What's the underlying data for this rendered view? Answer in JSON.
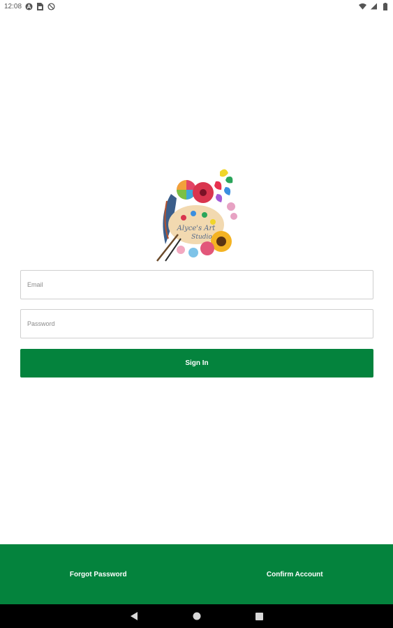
{
  "status_bar": {
    "time": "12:08",
    "left_icons": [
      "accessibility-icon",
      "sim-card-icon",
      "no-sync-icon"
    ],
    "right_icons": [
      "wifi-icon",
      "signal-icon",
      "battery-icon"
    ]
  },
  "logo": {
    "icon": "art-palette-flowers-logo",
    "text": "Alyce's Art Studio"
  },
  "form": {
    "email_placeholder": "Email",
    "password_placeholder": "Password",
    "signin_label": "Sign In"
  },
  "footer": {
    "forgot_password_label": "Forgot Password",
    "confirm_account_label": "Confirm Account"
  },
  "nav": {
    "icons": [
      "back-icon",
      "home-icon",
      "recents-icon"
    ]
  },
  "colors": {
    "primary_green": "#04833d",
    "background": "#ffffff",
    "nav_bar": "#000000"
  }
}
